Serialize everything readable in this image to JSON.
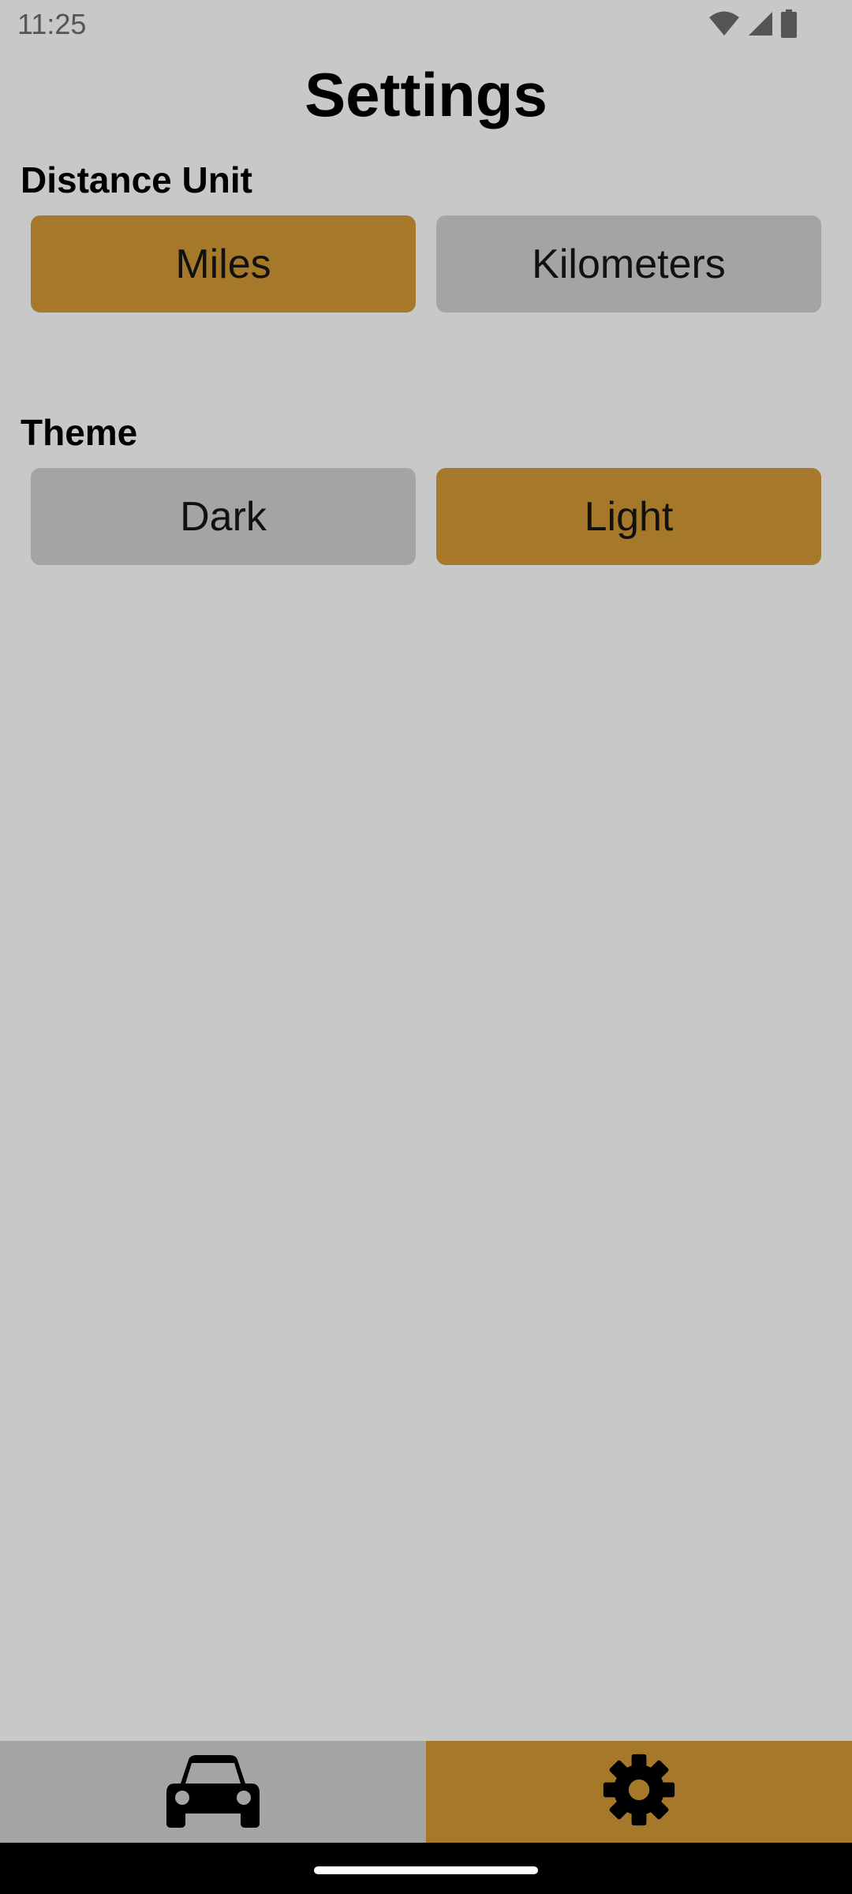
{
  "status_bar": {
    "time": "11:25",
    "icons": [
      "wifi-icon",
      "cellular-signal-icon",
      "battery-icon"
    ]
  },
  "page": {
    "title": "Settings"
  },
  "distance_unit": {
    "label": "Distance Unit",
    "options": [
      "Miles",
      "Kilometers"
    ],
    "selected": "Miles"
  },
  "theme": {
    "label": "Theme",
    "options": [
      "Dark",
      "Light"
    ],
    "selected": "Light"
  },
  "bottom_nav": {
    "tabs": [
      {
        "icon": "car-icon",
        "selected": false
      },
      {
        "icon": "gear-icon",
        "selected": true
      }
    ]
  },
  "colors": {
    "background": "#c8c8c8",
    "accent": "#a6782a",
    "inactive": "#a4a4a4",
    "text": "#000000"
  }
}
